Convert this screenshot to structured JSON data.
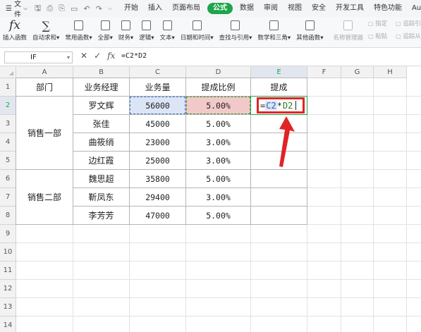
{
  "menu": {
    "file_label": "文件",
    "tabs": [
      "开始",
      "插入",
      "页面布局",
      "公式",
      "数据",
      "审阅",
      "视图",
      "安全",
      "开发工具",
      "特色功能",
      "AudTool"
    ],
    "active_tab": "公式"
  },
  "ribbon": {
    "insert_function": "插入函数",
    "autosum": "自动求和",
    "common_functions": "常用函数",
    "all": "全部",
    "finance": "财务",
    "logic": "逻辑",
    "text": "文本",
    "datetime": "日期和时间",
    "lookup": "查找与引用",
    "math": "数学和三角",
    "other": "其他函数",
    "name_manager": "名称管理器",
    "specify": "指定",
    "paste": "粘贴",
    "trace_precedents": "追踪引用",
    "trace_dependents": "追踪从属"
  },
  "formula_bar": {
    "name_box": "IF",
    "formula": "=C2*D2",
    "cancel_icon": "✕",
    "confirm_icon": "✓",
    "fx_label": "fx"
  },
  "columns": [
    "A",
    "B",
    "C",
    "D",
    "E",
    "F",
    "G",
    "H"
  ],
  "rows": [
    "1",
    "2",
    "3",
    "4",
    "5",
    "6",
    "7",
    "8",
    "9",
    "10",
    "11",
    "12",
    "13",
    "14"
  ],
  "headers": {
    "dept": "部门",
    "manager": "业务经理",
    "volume": "业务量",
    "ratio": "提成比例",
    "commission": "提成"
  },
  "departments": [
    "销售一部",
    "销售二部"
  ],
  "records": [
    {
      "manager": "罗文辉",
      "volume": "56000",
      "ratio": "5.00%"
    },
    {
      "manager": "张佳",
      "volume": "45000",
      "ratio": "5.00%"
    },
    {
      "manager": "曲筱绡",
      "volume": "23000",
      "ratio": "3.00%"
    },
    {
      "manager": "边红霞",
      "volume": "25000",
      "ratio": "3.00%"
    },
    {
      "manager": "魏思超",
      "volume": "35800",
      "ratio": "5.00%"
    },
    {
      "manager": "靳凤东",
      "volume": "29400",
      "ratio": "3.00%"
    },
    {
      "manager": "李芳芳",
      "volume": "47000",
      "ratio": "5.00%"
    }
  ],
  "edit_cell": {
    "eq": "=",
    "ref1": "C2",
    "op": "*",
    "ref2": "D2"
  },
  "colors": {
    "accent": "#1ea54b",
    "highlight_red": "#e02424",
    "ref1_fill": "#dbe5f5",
    "ref2_fill": "#f2c9c9"
  }
}
